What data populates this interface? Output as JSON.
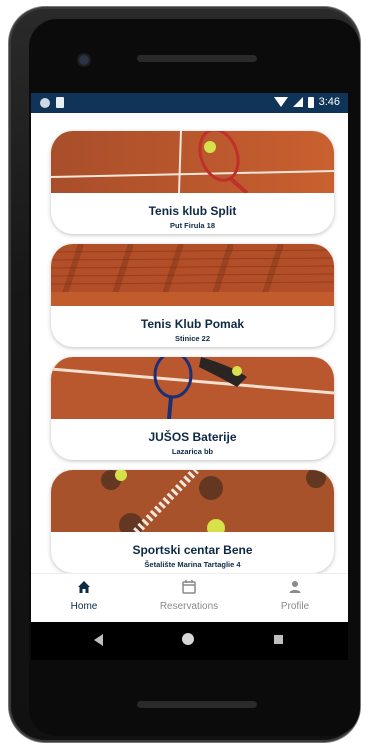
{
  "status_bar": {
    "time": "3:46"
  },
  "clubs": [
    {
      "name": "Tenis klub Split",
      "address": "Put Firula 18"
    },
    {
      "name": "Tenis Klub Pomak",
      "address": "Stinice 22"
    },
    {
      "name": "JUŠOS Baterije",
      "address": "Lazarica bb"
    },
    {
      "name": "Sportski centar Bene",
      "address": "Šetalište Marina Tartaglie 4"
    }
  ],
  "bottom_nav": {
    "items": [
      {
        "label": "Home",
        "icon": "home-icon",
        "active": true
      },
      {
        "label": "Reservations",
        "icon": "calendar-icon",
        "active": false
      },
      {
        "label": "Profile",
        "icon": "person-icon",
        "active": false
      }
    ]
  },
  "colors": {
    "status_bar": "#0f3457",
    "title_text": "#0f2a45",
    "clay": "#b9562c"
  }
}
